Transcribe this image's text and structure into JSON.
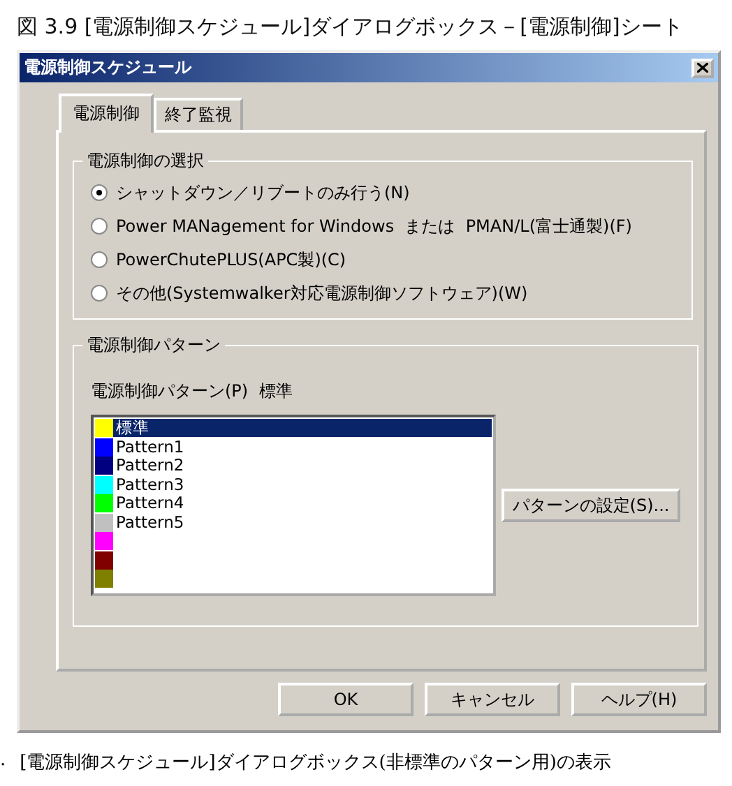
{
  "caption": "図 3.9 [電源制御スケジュール]ダイアログボックス－[電源制御]シート",
  "window": {
    "title": "電源制御スケジュール"
  },
  "tabs": [
    {
      "label": "電源制御",
      "selected": true
    },
    {
      "label": "終了監視",
      "selected": false
    }
  ],
  "control_selection": {
    "title": "電源制御の選択",
    "options": [
      {
        "label": "シャットダウン／リブートのみ行う(N)",
        "selected": true
      },
      {
        "label": "Power MANagement for Windows  または  PMAN/L(富士通製)(F)",
        "selected": false
      },
      {
        "label": "PowerChutePLUS(APC製)(C)",
        "selected": false
      },
      {
        "label": "その他(Systemwalker対応電源制御ソフトウェア)(W)",
        "selected": false
      }
    ]
  },
  "control_pattern": {
    "title": "電源制御パターン",
    "field_label": "電源制御パターン(P)",
    "current": "標準",
    "patterns": [
      {
        "label": "標準",
        "color": "#ffff00",
        "selected": true
      },
      {
        "label": "Pattern1",
        "color": "#0000ff",
        "selected": false
      },
      {
        "label": "Pattern2",
        "color": "#000080",
        "selected": false
      },
      {
        "label": "Pattern3",
        "color": "#00ffff",
        "selected": false
      },
      {
        "label": "Pattern4",
        "color": "#00ff00",
        "selected": false
      },
      {
        "label": "Pattern5",
        "color": "#c0c0c0",
        "selected": false
      },
      {
        "color": "#ff00ff",
        "selected": false
      },
      {
        "color": "#800000",
        "selected": false
      },
      {
        "color": "#808000",
        "selected": false
      }
    ],
    "settings_button": "パターンの設定(S)..."
  },
  "buttons": [
    "OK",
    "キャンセル",
    "ヘルプ(H)"
  ],
  "following": {
    "marker": ".",
    "heading": "[電源制御スケジュール]ダイアログボックス(非標準のパターン用)の表示"
  }
}
